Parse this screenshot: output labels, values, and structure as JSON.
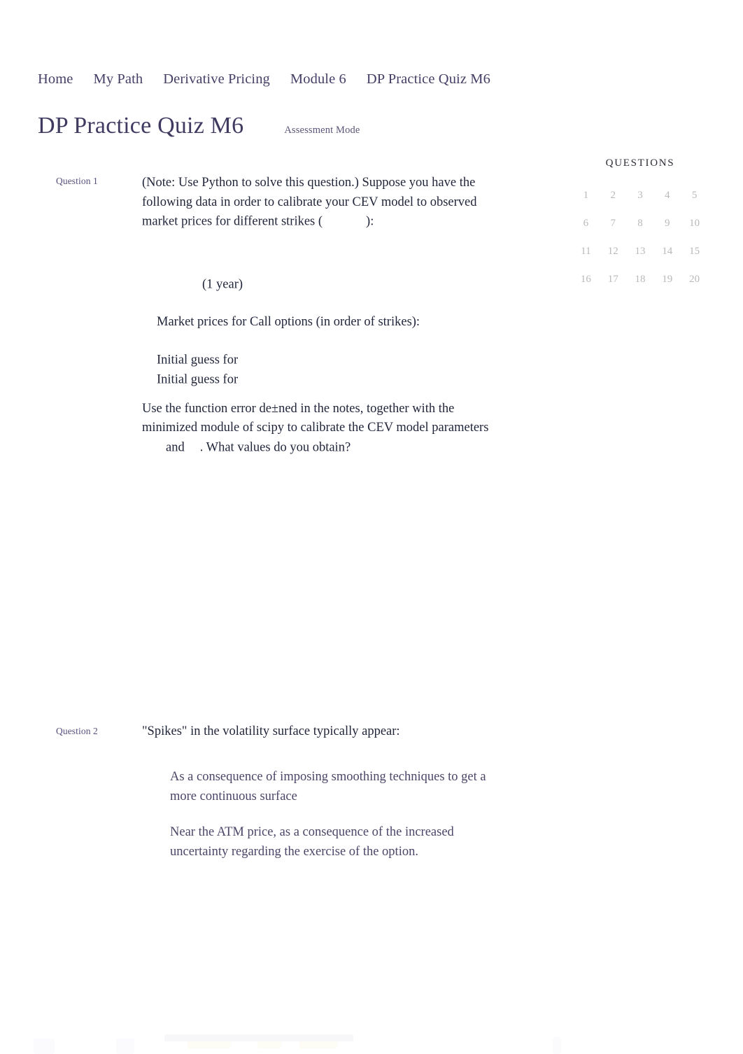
{
  "breadcrumb": {
    "items": [
      {
        "label": "Home"
      },
      {
        "label": "My Path"
      },
      {
        "label": "Derivative Pricing"
      },
      {
        "label": "Module 6"
      },
      {
        "label": "DP Practice Quiz M6"
      }
    ]
  },
  "header": {
    "title": "DP Practice Quiz M6",
    "mode_label": "Assessment Mode"
  },
  "questions_panel": {
    "heading": "QUESTIONS",
    "numbers": [
      "1",
      "2",
      "3",
      "4",
      "5",
      "6",
      "7",
      "8",
      "9",
      "10",
      "11",
      "12",
      "13",
      "14",
      "15",
      "16",
      "17",
      "18",
      "19",
      "20"
    ]
  },
  "quiz": {
    "questions": [
      {
        "label": "Question 1",
        "stem_part_1": "(Note:  Use Python to solve this question.) Suppose you have the following data in order to calibrate your CEV model to observed market prices for different strikes (",
        "stem_part_2": "):",
        "term_line": "(1 year)",
        "market_prices_line": "Market prices for Call options (in order of strikes):",
        "initial_guess_1": "Initial guess for",
        "initial_guess_2": "Initial guess for",
        "closing_part_1": "Use the function error de±ned in the notes, together with the minimized module of scipy to calibrate the CEV model parameters",
        "closing_part_2": "and",
        "closing_part_3": ". What values do you obtain?",
        "options": []
      },
      {
        "label": "Question 2",
        "stem_part_1": "\"Spikes\" in the volatility surface typically appear:",
        "options": [
          {
            "text": "As a consequence of imposing smoothing techniques to get a more continuous surface"
          },
          {
            "text": "Near the ATM price, as a consequence of the increased uncertainty regarding the exercise of the option."
          }
        ]
      }
    ]
  }
}
